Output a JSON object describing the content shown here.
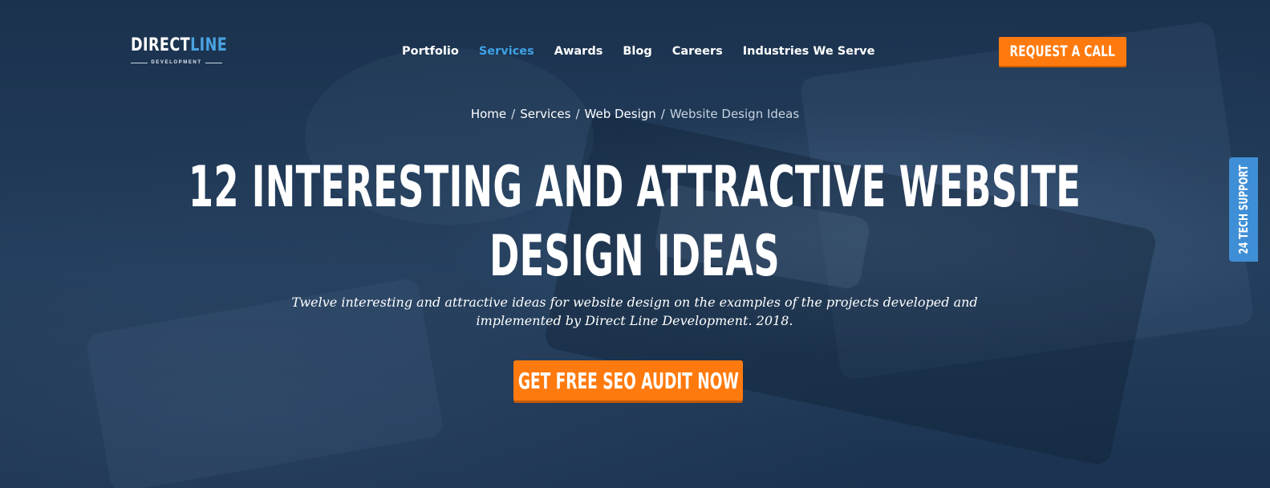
{
  "logo": {
    "part1": "DIRECT",
    "part2": "LINE",
    "sub": "DEVELOPMENT"
  },
  "nav": {
    "items": [
      {
        "label": "Portfolio",
        "active": false
      },
      {
        "label": "Services",
        "active": true
      },
      {
        "label": "Awards",
        "active": false
      },
      {
        "label": "Blog",
        "active": false
      },
      {
        "label": "Careers",
        "active": false
      },
      {
        "label": "Industries We Serve",
        "active": false
      }
    ]
  },
  "header": {
    "cta_label": "REQUEST A CALL"
  },
  "breadcrumb": {
    "items": [
      "Home",
      "Services",
      "Web Design"
    ],
    "separator": "/",
    "current": "Website Design Ideas"
  },
  "hero": {
    "title": "12 INTERESTING AND ATTRACTIVE WEBSITE DESIGN IDEAS",
    "subtitle": "Twelve interesting and attractive ideas for website design on the examples of the projects developed and implemented by Direct Line Development. 2018.",
    "cta_label": "GET FREE SEO AUDIT NOW"
  },
  "side_tab": {
    "label": "24 TECH SUPPORT"
  },
  "colors": {
    "accent_orange": "#ff7a0e",
    "accent_blue": "#3fa2e6",
    "background": "#1d3552"
  }
}
